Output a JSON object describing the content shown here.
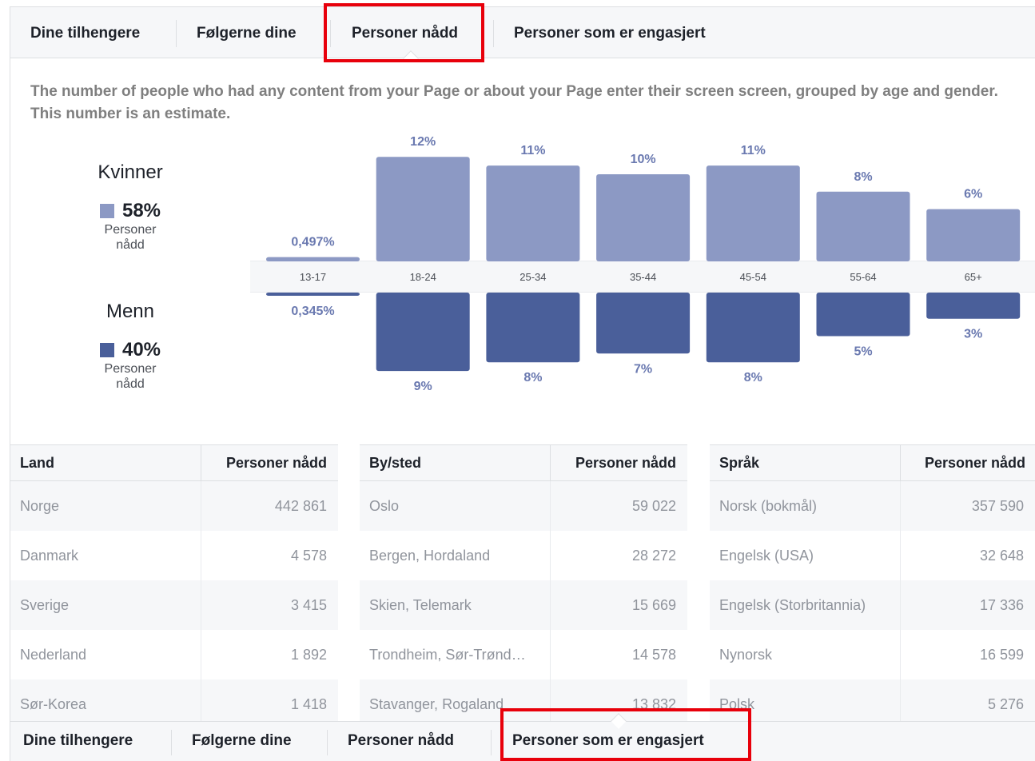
{
  "tabs_top": [
    {
      "label": "Dine tilhengere"
    },
    {
      "label": "Følgerne dine"
    },
    {
      "label": "Personer nådd"
    },
    {
      "label": "Personer som er engasjert"
    }
  ],
  "description": "The number of people who had any content from your Page or about your Page enter their screen screen, grouped by age and gender. This number is an estimate.",
  "legend": {
    "women": {
      "name": "Kvinner",
      "pct": "58%",
      "sub1": "Personer",
      "sub2": "nådd",
      "color": "#8c99c4"
    },
    "men": {
      "name": "Menn",
      "pct": "40%",
      "sub1": "Personer",
      "sub2": "nådd",
      "color": "#4a5f9a"
    }
  },
  "chart_data": {
    "type": "bar",
    "categories": [
      "13-17",
      "18-24",
      "25-34",
      "35-44",
      "45-54",
      "55-64",
      "65+"
    ],
    "series": [
      {
        "name": "Kvinner",
        "values": [
          0.497,
          12,
          11,
          10,
          11,
          8,
          6
        ],
        "labels": [
          "0,497%",
          "12%",
          "11%",
          "10%",
          "11%",
          "8%",
          "6%"
        ],
        "color": "#8c99c4"
      },
      {
        "name": "Menn",
        "values": [
          0.345,
          9,
          8,
          7,
          8,
          5,
          3
        ],
        "labels": [
          "0,345%",
          "9%",
          "8%",
          "7%",
          "8%",
          "5%",
          "3%"
        ],
        "color": "#4a5f9a"
      }
    ]
  },
  "tables": [
    {
      "col1": "Land",
      "col2": "Personer nådd",
      "rows": [
        {
          "name": "Norge",
          "value": "442 861"
        },
        {
          "name": "Danmark",
          "value": "4 578"
        },
        {
          "name": "Sverige",
          "value": "3 415"
        },
        {
          "name": "Nederland",
          "value": "1 892"
        },
        {
          "name": "Sør-Korea",
          "value": "1 418"
        }
      ]
    },
    {
      "col1": "By/sted",
      "col2": "Personer nådd",
      "rows": [
        {
          "name": "Oslo",
          "value": "59 022"
        },
        {
          "name": "Bergen, Hordaland",
          "value": "28 272"
        },
        {
          "name": "Skien, Telemark",
          "value": "15 669"
        },
        {
          "name": "Trondheim, Sør-Trønd…",
          "value": "14 578"
        },
        {
          "name": "Stavanger, Rogaland",
          "value": "13 832"
        }
      ]
    },
    {
      "col1": "Språk",
      "col2": "Personer nådd",
      "rows": [
        {
          "name": "Norsk (bokmål)",
          "value": "357 590"
        },
        {
          "name": "Engelsk (USA)",
          "value": "32 648"
        },
        {
          "name": "Engelsk (Storbritannia)",
          "value": "17 336"
        },
        {
          "name": "Nynorsk",
          "value": "16 599"
        },
        {
          "name": "Polsk",
          "value": "5 276"
        }
      ]
    }
  ],
  "tabs_bottom": [
    {
      "label": "Dine tilhengere"
    },
    {
      "label": "Følgerne dine"
    },
    {
      "label": "Personer nådd"
    },
    {
      "label": "Personer som er engasjert"
    }
  ],
  "colors": {
    "highlight": "#e8000b"
  }
}
